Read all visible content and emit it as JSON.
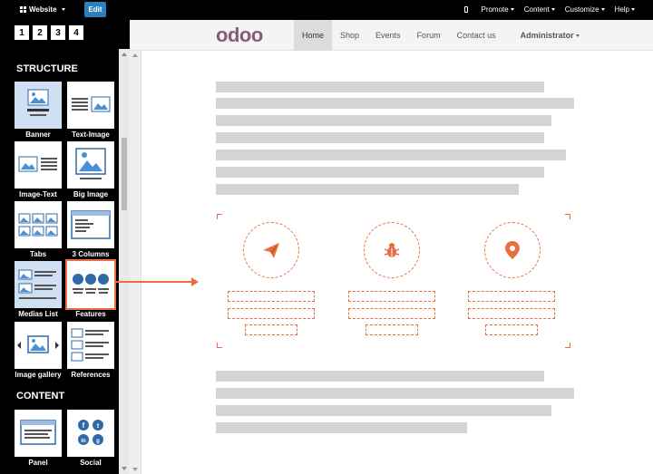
{
  "topbar": {
    "website_label": "Website",
    "edit_label": "Edit",
    "menus": [
      "Promote",
      "Content",
      "Customize",
      "Help"
    ]
  },
  "sidebar": {
    "pages": [
      "1",
      "2",
      "3",
      "4"
    ],
    "structure_title": "STRUCTURE",
    "structure_blocks": [
      "Banner",
      "Text-Image",
      "Image-Text",
      "Big Image",
      "Tabs",
      "3 Columns",
      "Medias List",
      "Features",
      "Image gallery",
      "References"
    ],
    "content_title": "CONTENT",
    "content_blocks": [
      "Panel",
      "Social"
    ]
  },
  "site": {
    "logo_odoo": "odoo",
    "nav": [
      "Home",
      "Shop",
      "Events",
      "Forum",
      "Contact us"
    ],
    "user": "Administrator"
  },
  "colors": {
    "accent": "#e87040",
    "edit_button": "#2c7fbf",
    "logo_purple": "#875a7b",
    "placeholder_gray": "#d4d4d4"
  },
  "icons": {
    "feature_1": "paper-plane-icon",
    "feature_2": "bug-icon",
    "feature_3": "map-marker-icon"
  }
}
